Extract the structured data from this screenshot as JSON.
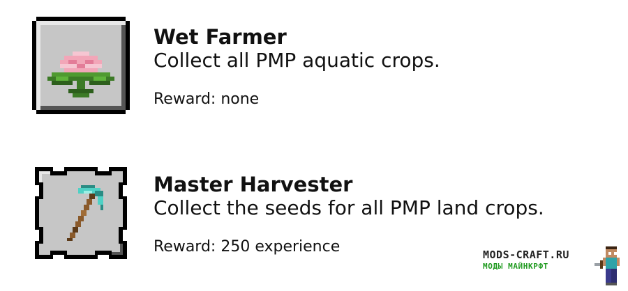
{
  "achievements": [
    {
      "title": "Wet Farmer",
      "description": "Collect all PMP aquatic crops.",
      "reward": "Reward: none",
      "icon": "lotus-flower-icon",
      "frame": "square-frame"
    },
    {
      "title": "Master Harvester",
      "description": "Collect the seeds for all PMP land crops.",
      "reward": "Reward: 250 experience",
      "icon": "hoe-icon",
      "frame": "spiky-challenge-frame"
    }
  ],
  "watermark": {
    "line1": "MODS-CRAFT.RU",
    "line2": "МОДЫ МАЙНКРФТ",
    "icon": "steve-with-sword-icon"
  },
  "colors": {
    "frame_fill": "#c6c6c6",
    "frame_border": "#000000",
    "lotus_pink": "#f2a6b8",
    "lotus_leaf": "#3c7a26",
    "hoe_head": "#4fd1c5",
    "hoe_handle": "#8a5a2b",
    "watermark_green": "#1f9a1f"
  }
}
